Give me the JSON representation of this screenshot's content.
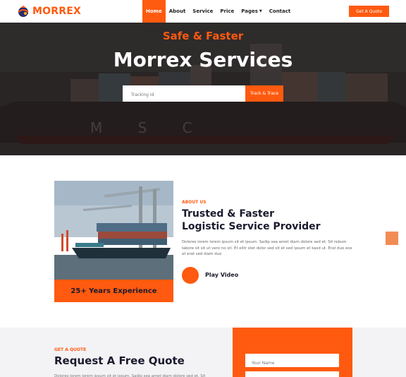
{
  "nav": {
    "logo_text": "MORREX",
    "menu": [
      {
        "label": "Home",
        "active": true
      },
      {
        "label": "About",
        "active": false
      },
      {
        "label": "Service",
        "active": false
      },
      {
        "label": "Price",
        "active": false
      },
      {
        "label": "Pages",
        "active": false,
        "dropdown": true
      },
      {
        "label": "Contact",
        "active": false
      }
    ],
    "cta_label": "Get A Quote"
  },
  "hero": {
    "subtitle": "Safe & Faster",
    "title": "Morrex Services",
    "tracking_placeholder": "Tracking Id",
    "track_button": "Track & Trace",
    "ship_lettering": "M S C"
  },
  "about": {
    "label": "ABOUT US",
    "title_line1": "Trusted & Faster",
    "title_line2": "Logistic Service Provider",
    "text": "Dolores lorem lorem ipsum sit et ipsum. Sadip sea amet diam dolore sed et. Sit rebum labore sit sit ut vero no sit. Et elitr stet dolor sed sit et sed ipsum et kasd ut. Erat duo eos et erat sed diam duo",
    "experience": "25+ Years Experience",
    "play_label": "Play Video"
  },
  "quote": {
    "label": "GET A QUOTE",
    "title": "Request A Free Quote",
    "text": "Dolores lorem lorem ipsum sit et ipsum. Sadip sea amet diam dolore sed et. Sit",
    "name_placeholder": "Your Name"
  },
  "colors": {
    "accent": "#ff5a0f",
    "dark": "#1a1a2e",
    "light_bg": "#f3f3f5"
  }
}
